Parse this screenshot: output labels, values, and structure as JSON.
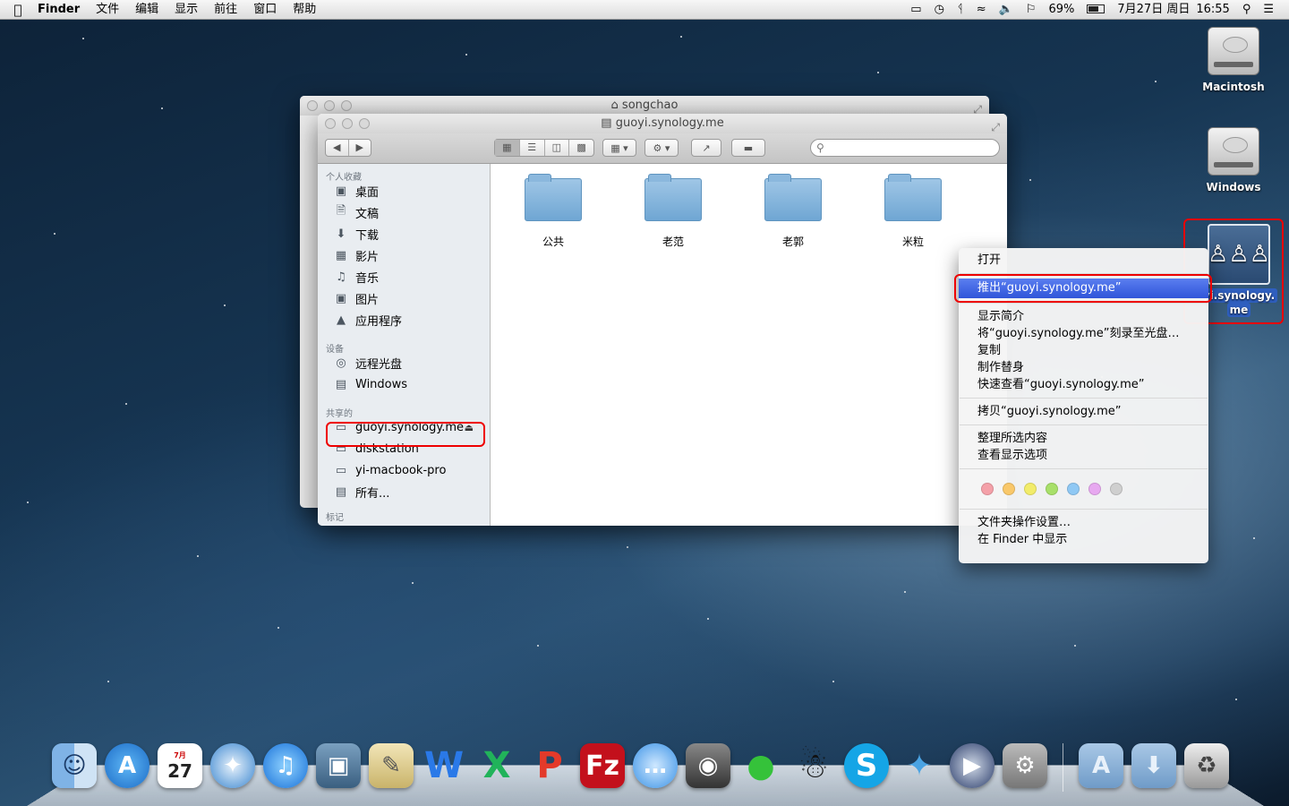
{
  "menubar": {
    "apple_icon": "apple-icon",
    "app_name": "Finder",
    "menus": [
      "文件",
      "编辑",
      "显示",
      "前往",
      "窗口",
      "帮助"
    ],
    "status": {
      "battery_percent": "69%",
      "date": "7月27日 周日",
      "time": "16:55"
    }
  },
  "desktop": {
    "icons": [
      {
        "label": "Macintosh"
      },
      {
        "label": "Windows"
      },
      {
        "label_line1": "yi.synology.",
        "label_line2": "me"
      }
    ]
  },
  "back_window": {
    "title": "songchao"
  },
  "front_window": {
    "title": "guoyi.synology.me",
    "sidebar": {
      "favorites_header": "个人收藏",
      "favorites": [
        "桌面",
        "文稿",
        "下载",
        "影片",
        "音乐",
        "图片",
        "应用程序"
      ],
      "devices_header": "设备",
      "devices": [
        "远程光盘",
        "Windows"
      ],
      "shared_header": "共享的",
      "shared": [
        "guoyi.synology.me",
        "diskstation",
        "yi-macbook-pro",
        "所有..."
      ],
      "tags_header": "标记"
    },
    "folders": [
      "公共",
      "老范",
      "老郭",
      "米粒"
    ]
  },
  "context_menu": {
    "items_group1": [
      "打开"
    ],
    "highlighted": "推出“guoyi.synology.me”",
    "items_group2": [
      "显示简介",
      "将“guoyi.synology.me”刻录至光盘…",
      "复制",
      "制作替身",
      "快速查看“guoyi.synology.me”"
    ],
    "items_group3": [
      "拷贝“guoyi.synology.me”"
    ],
    "items_group4": [
      "整理所选内容",
      "查看显示选项"
    ],
    "tag_colors": [
      "#f4a0a8",
      "#f9c86a",
      "#f2ec6a",
      "#a8e06a",
      "#8fc8f4",
      "#e7a8f0",
      "#cfcfcf"
    ],
    "items_group5": [
      "文件夹操作设置…",
      "在 Finder 中显示"
    ]
  },
  "dock": {
    "apps": [
      "finder",
      "app-store",
      "calendar",
      "safari",
      "itunes",
      "iphoto",
      "preview",
      "wps-writer",
      "wps-spreadsheets",
      "wps-presentation",
      "filezilla",
      "messages",
      "facetime",
      "wechat",
      "qq",
      "skype",
      "mail-bird",
      "quicktime",
      "system-preferences"
    ],
    "calendar_day": "27",
    "calendar_month": "7月"
  }
}
